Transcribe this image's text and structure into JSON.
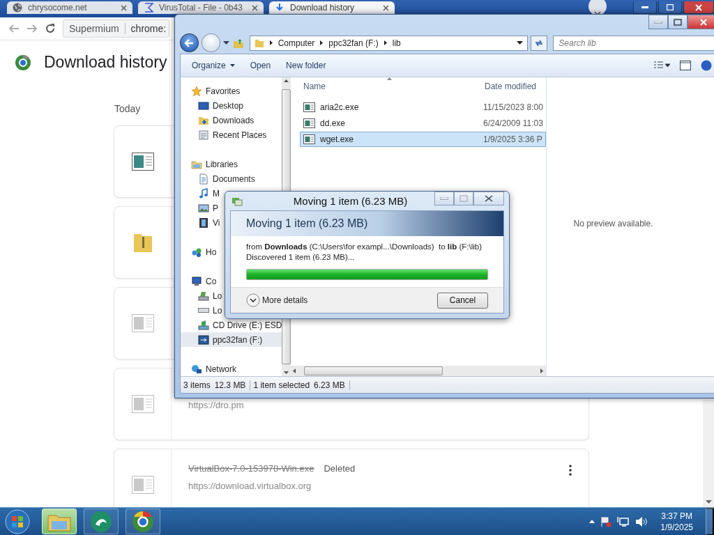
{
  "browser": {
    "tabs": [
      {
        "title": "chrysocome.net",
        "kind": "globe",
        "selected": false
      },
      {
        "title": "VirusTotal - File - 0b43",
        "kind": "sigma",
        "selected": false
      },
      {
        "title": "Download history",
        "kind": "download",
        "selected": true
      }
    ],
    "toolbar": {
      "site_chip": "Supermium",
      "url": "chrome:"
    },
    "page": {
      "title": "Download history",
      "section": "Today",
      "downloads": [
        {
          "kind": "program",
          "deleted": false
        },
        {
          "kind": "archive",
          "deleted": false
        },
        {
          "kind": "program",
          "deleted": true
        },
        {
          "kind": "program",
          "deleted": true,
          "url": "https://dro.pm"
        },
        {
          "kind": "program",
          "deleted": true,
          "file_name": "VirtualBox-7.0-153978-Win.exe",
          "status": "Deleted",
          "url": "https://download.virtualbox.org"
        }
      ]
    }
  },
  "explorer": {
    "breadcrumb": [
      "Computer",
      "ppc32fan (F:)",
      "lib"
    ],
    "search_placeholder": "Search lib",
    "commands": [
      {
        "label": "Organize",
        "dropdown": true
      },
      {
        "label": "Open",
        "dropdown": false
      },
      {
        "label": "New folder",
        "dropdown": false
      }
    ],
    "navigation": [
      {
        "label": "Favorites",
        "kind": "favorites",
        "selected": false,
        "children": [
          {
            "label": "Desktop",
            "kind": "desktop",
            "selected": false
          },
          {
            "label": "Downloads",
            "kind": "downloads",
            "selected": false
          },
          {
            "label": "Recent Places",
            "kind": "recent",
            "selected": false
          }
        ]
      },
      {
        "label": "Libraries",
        "kind": "libraries",
        "selected": false,
        "children": [
          {
            "label": "Documents",
            "kind": "documents",
            "selected": false
          },
          {
            "label": "M",
            "kind": "music",
            "selected": false
          },
          {
            "label": "P",
            "kind": "pictures",
            "selected": false
          },
          {
            "label": "Vi",
            "kind": "videos",
            "selected": false
          }
        ]
      },
      {
        "label": "Ho",
        "kind": "homegroup",
        "selected": false
      },
      {
        "label": "Co",
        "kind": "computer",
        "selected": false,
        "children": [
          {
            "label": "Lo",
            "kind": "local-disk",
            "selected": false
          },
          {
            "label": "Lo",
            "kind": "disk",
            "selected": false
          },
          {
            "label": "CD Drive (E:) ESD",
            "kind": "cd-drive",
            "selected": false
          },
          {
            "label": "ppc32fan (F:)",
            "kind": "usb-drive",
            "selected": true
          }
        ]
      },
      {
        "label": "Network",
        "kind": "network",
        "selected": false
      }
    ],
    "columns": [
      "Name",
      "Date modified"
    ],
    "files": [
      {
        "name": "aria2c.exe",
        "date_modified": "11/15/2023 8:00",
        "selected": false
      },
      {
        "name": "dd.exe",
        "date_modified": "6/24/2009 11:03",
        "selected": false
      },
      {
        "name": "wget.exe",
        "date_modified": "1/9/2025 3:36 P",
        "selected": true
      }
    ],
    "preview": "No preview available.",
    "status": {
      "count": "3 items",
      "total_size": "12.3 MB",
      "selection": "1 item selected",
      "selection_size": "6.23 MB"
    }
  },
  "dialog": {
    "title": "Moving 1 item (6.23 MB)",
    "heading": "Moving 1 item (6.23 MB)",
    "source_line": "from **Downloads** (C:\\Users\\for exampl...\\Downloads)  to **lib** (F:\\lib)",
    "status": "Discovered 1 item (6.23 MB)...",
    "progress": {
      "level": 1.0
    },
    "details_toggle": "More details",
    "cancel": "Cancel"
  },
  "taskbar": {
    "apps": [
      {
        "kind": "folder",
        "active": true
      },
      {
        "kind": "swirl",
        "active": false
      },
      {
        "kind": "browser",
        "active": false
      }
    ],
    "clock": {
      "time": "3:37 PM",
      "date": "1/9/2025"
    }
  }
}
